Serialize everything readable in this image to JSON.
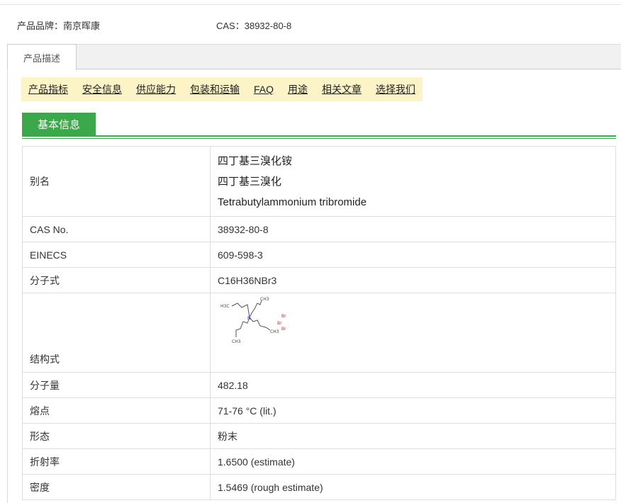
{
  "brand": {
    "label": "产品品牌：",
    "value": "南京晖康"
  },
  "cas_top": {
    "label": "CAS：",
    "value": "38932-80-8"
  },
  "tabs": [
    {
      "label": "产品描述"
    }
  ],
  "nav": [
    {
      "label": "产品指标"
    },
    {
      "label": "安全信息"
    },
    {
      "label": "供应能力"
    },
    {
      "label": "包装和运输"
    },
    {
      "label": "FAQ"
    },
    {
      "label": "用途"
    },
    {
      "label": "相关文章"
    },
    {
      "label": "选择我们"
    }
  ],
  "section_title": "基本信息",
  "alias": {
    "key": "别名",
    "values": [
      "四丁基三溴化铵",
      "四丁基三溴化",
      "Tetrabutylammonium tribromide"
    ]
  },
  "rows_a": [
    {
      "key": "CAS No.",
      "value": "38932-80-8"
    },
    {
      "key": "EINECS",
      "value": "609-598-3"
    },
    {
      "key": "分子式",
      "value": "C16H36NBr3"
    }
  ],
  "structure": {
    "key": "结构式",
    "atom_labels": {
      "methyl": "CH3",
      "h3c": "H3C",
      "nitrogen": "N",
      "bromine": "Br"
    }
  },
  "rows_b": [
    {
      "key": "分子量",
      "value": "482.18"
    },
    {
      "key": "熔点",
      "value": "71-76 °C (lit.)"
    },
    {
      "key": "形态",
      "value": "粉末"
    },
    {
      "key": "折射率",
      "value": "1.6500 (estimate)"
    },
    {
      "key": "密度",
      "value": "1.5469 (rough estimate)"
    }
  ],
  "colors": {
    "accent_green": "#3aa84b",
    "nav_bg": "#fcf3c6",
    "border": "#dddddd"
  }
}
